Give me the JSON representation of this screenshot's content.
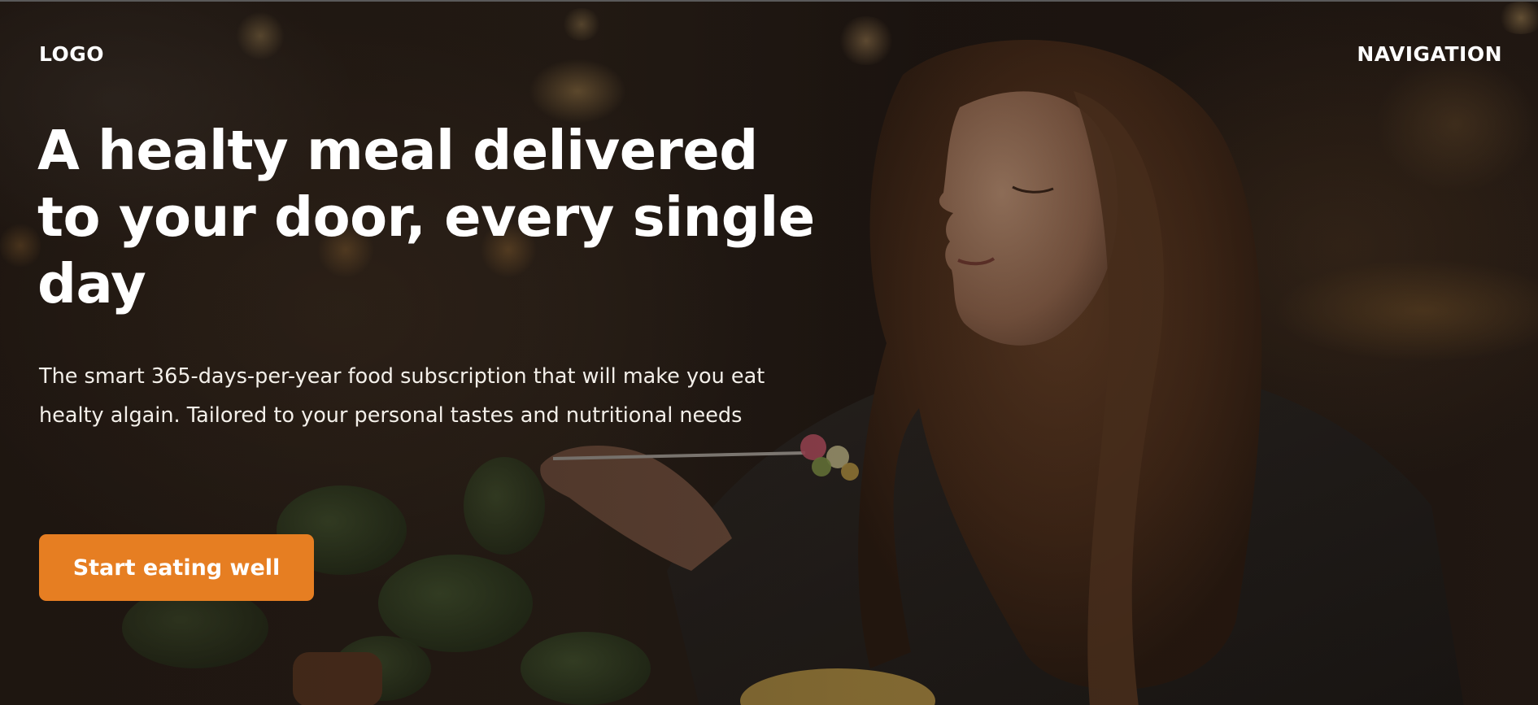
{
  "header": {
    "logo_text": "LOGO",
    "navigation_label": "NAVIGATION"
  },
  "hero": {
    "headline": "A healty meal delivered to your door, every single day",
    "description": "The smart 365-days-per-year food subscription that will make you eat healty algain. Tailored to your personal tastes and nutritional needs",
    "cta_label": "Start eating well"
  },
  "colors": {
    "accent": "#e67e22",
    "text": "#ffffff",
    "background_dark": "#1e1612"
  },
  "image": {
    "subject": "woman-eating-salad-photo"
  }
}
